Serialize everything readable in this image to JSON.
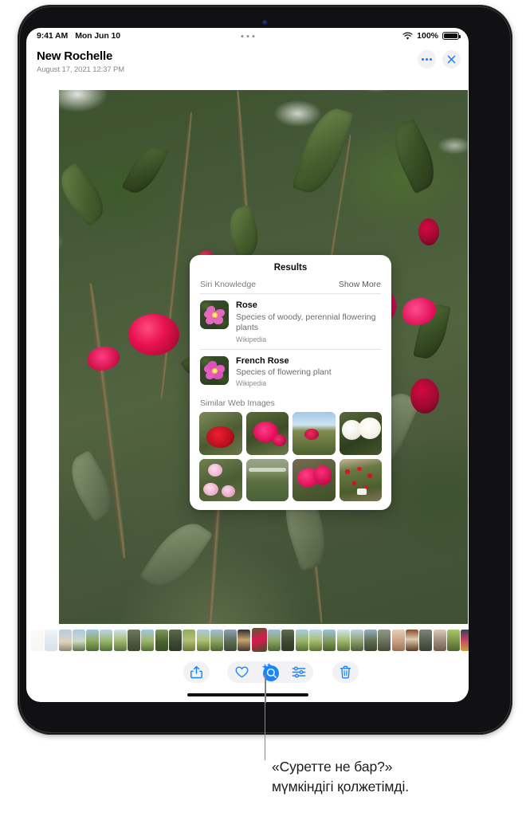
{
  "status_bar": {
    "time": "9:41 AM",
    "date": "Mon Jun 10",
    "battery_percent": "100%",
    "wifi_icon": "wifi-icon",
    "battery_icon": "battery-full-icon",
    "multitask_handle_icon": "multitask-ellipsis-icon"
  },
  "header": {
    "title": "New Rochelle",
    "subtitle": "August 17, 2021  12:37 PM",
    "more_icon": "ellipsis-icon",
    "close_icon": "close-x-icon"
  },
  "photo": {
    "name": "rose-bush-photo",
    "alt_label": "Rose bush with pink and red roses"
  },
  "results_popup": {
    "title": "Results",
    "section_label": "Siri Knowledge",
    "show_more_label": "Show More",
    "items": [
      {
        "name": "Rose",
        "description": "Species of woody, perennial flowering plants",
        "source": "Wikipedia",
        "thumb_icon": "pink-rose-thumb"
      },
      {
        "name": "French Rose",
        "description": "Species of flowering plant",
        "source": "Wikipedia",
        "thumb_icon": "pink-rose-thumb"
      }
    ],
    "similar_label": "Similar Web Images",
    "similar_images": [
      {
        "label": "red-rose-closeup"
      },
      {
        "label": "magenta-rose-bush"
      },
      {
        "label": "rose-field-with-sky"
      },
      {
        "label": "white-roses"
      },
      {
        "label": "pale-pink-roses"
      },
      {
        "label": "rose-nursery-rows"
      },
      {
        "label": "deep-pink-rose-buds"
      },
      {
        "label": "red-rose-shrub-with-tag"
      }
    ]
  },
  "toolbar": {
    "share_icon": "share-up-arrow-icon",
    "favorite_icon": "heart-icon",
    "visual_look_up_icon": "visual-look-up-sparkle-icon",
    "adjust_icon": "adjustments-sliders-icon",
    "delete_icon": "trash-icon"
  },
  "filmstrip": {
    "name": "photo-filmstrip",
    "selected_index": 16,
    "thumb_count": 33
  },
  "callout": {
    "caption_line_1": "«Суретте не бар?»",
    "caption_line_2": "мүмкіндігі қолжетімді."
  },
  "colors": {
    "accent_blue": "#1a84ff",
    "pill_gray": "#f2f2f4",
    "text_primary": "#0b0b0b",
    "text_secondary": "#6c6c71",
    "text_tertiary": "#8d8d92"
  }
}
